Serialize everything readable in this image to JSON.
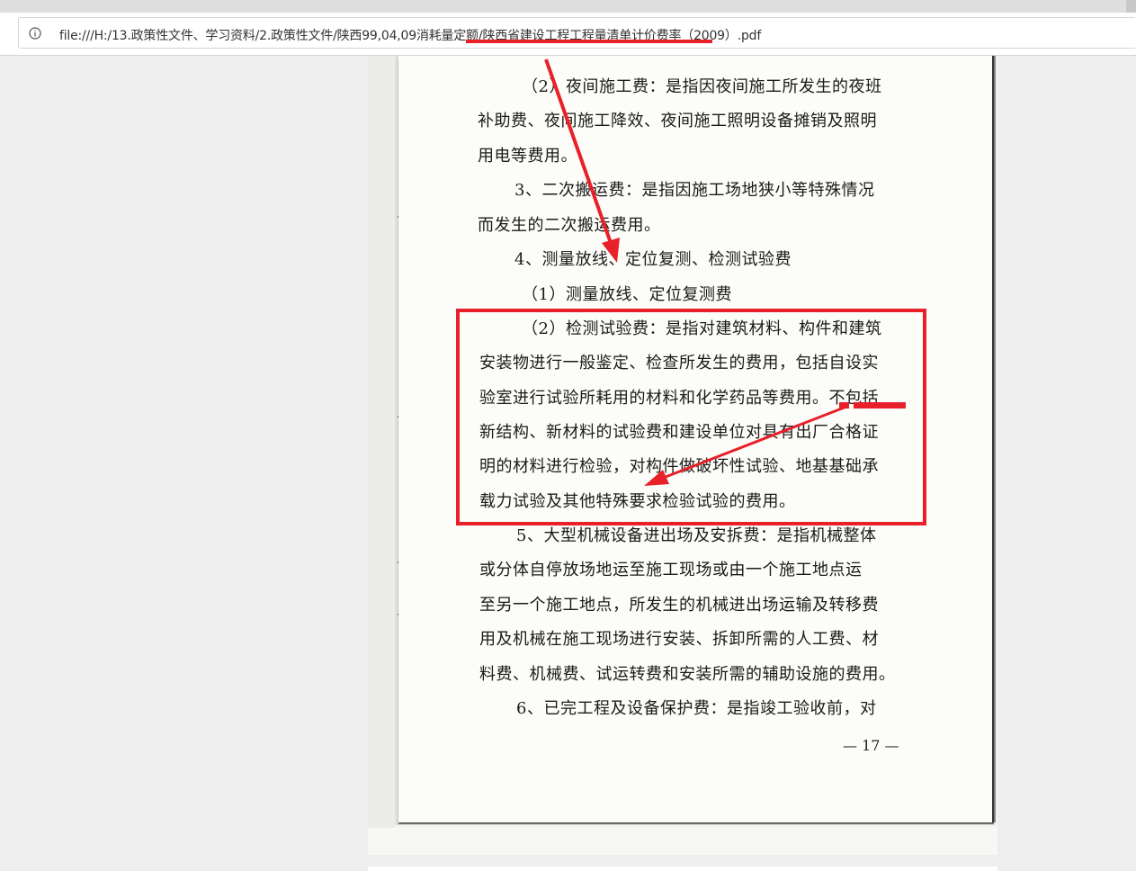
{
  "address_bar": {
    "url": "file:///H:/13.政策性文件、学习资料/2.政策性文件/陕西99,04,09消耗量定额/陕西省建设工程工程量清单计价费率（2009）.pdf",
    "info_icon": "info-circle-icon"
  },
  "document": {
    "lines": [
      "（2）夜间施工费：是指因夜间施工所发生的夜班",
      "补助费、夜间施工降效、夜间施工照明设备摊销及照明",
      "用电等费用。",
      "3、二次搬运费：是指因施工场地狭小等特殊情况",
      "而发生的二次搬运费用。",
      "4、测量放线、定位复测、检测试验费",
      "（1）测量放线、定位复测费",
      "（2）检测试验费：是指对建筑材料、构件和建筑",
      "安装物进行一般鉴定、检查所发生的费用，包括自设实",
      "验室进行试验所耗用的材料和化学药品等费用。不包括",
      "新结构、新材料的试验费和建设单位对具有出厂合格证",
      "明的材料进行检验，对构件做破坏性试验、地基基础承",
      "载力试验及其他特殊要求检验试验的费用。",
      "5、大型机械设备进出场及安拆费：是指机械整体",
      "或分体自停放场地运至施工现场或由一个施工地点运",
      "至另一个施工地点，所发生的机械进出场运输及转移费",
      "用及机械在施工现场进行安装、拆卸所需的人工费、材",
      "料费、机械费、试运转费和安装所需的辅助设施的费用。",
      "6、已完工程及设备保护费：是指竣工验收前，对"
    ],
    "page_number": "— 17 —"
  },
  "annotation_color": "#e8202a"
}
